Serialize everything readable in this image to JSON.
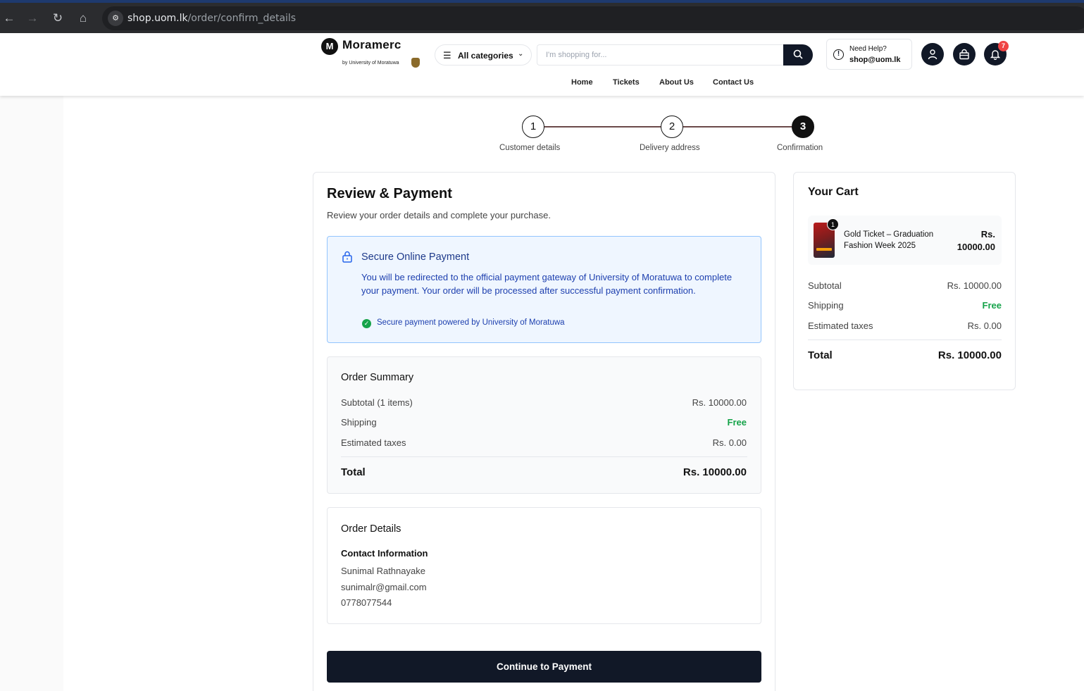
{
  "browser": {
    "back_glyph": "←",
    "forward_glyph": "→",
    "reload_glyph": "↻",
    "home_glyph": "⌂",
    "url_host": "shop.uom.lk",
    "url_path": "/order/confirm_details"
  },
  "header": {
    "brand_name": "Moramerc",
    "brand_sub": "by University of Moratuwa",
    "categories_label": "All categories",
    "search_placeholder": "I'm shopping for...",
    "help_label": "Need Help?",
    "help_email": "shop@uom.lk",
    "notification_count": "7",
    "nav": [
      "Home",
      "Tickets",
      "About Us",
      "Contact Us"
    ],
    "icons": [
      "search-icon",
      "info-icon",
      "user-icon",
      "bag-icon",
      "bell-icon",
      "menu-icon",
      "chevron-down-icon"
    ]
  },
  "stepper": {
    "steps": [
      {
        "number": "1",
        "label": "Customer details",
        "active": false
      },
      {
        "number": "2",
        "label": "Delivery address",
        "active": false
      },
      {
        "number": "3",
        "label": "Confirmation",
        "active": true
      }
    ]
  },
  "review": {
    "title": "Review & Payment",
    "subtitle": "Review your order details and complete your purchase.",
    "secure": {
      "title": "Secure Online Payment",
      "text": "You will be redirected to the official payment gateway of University of Moratuwa to complete your payment. Your order will be processed after successful payment confirmation.",
      "note": "Secure payment powered by University of Moratuwa"
    },
    "summary": {
      "title": "Order Summary",
      "subtotal_label": "Subtotal (1 items)",
      "subtotal_value": "Rs. 10000.00",
      "shipping_label": "Shipping",
      "shipping_value": "Free",
      "taxes_label": "Estimated taxes",
      "taxes_value": "Rs. 0.00",
      "total_label": "Total",
      "total_value": "Rs. 10000.00"
    },
    "details": {
      "title": "Order Details",
      "contact_title": "Contact Information",
      "name": "Sunimal Rathnayake",
      "email": "sunimalr@gmail.com",
      "phone": "0778077544"
    },
    "continue_label": "Continue to Payment"
  },
  "cart": {
    "title": "Your Cart",
    "item": {
      "quantity": "1",
      "name": "Gold Ticket – Graduation Fashion Week 2025",
      "price": "Rs. 10000.00"
    },
    "subtotal_label": "Subtotal",
    "subtotal_value": "Rs. 10000.00",
    "shipping_label": "Shipping",
    "shipping_value": "Free",
    "taxes_label": "Estimated taxes",
    "taxes_value": "Rs. 0.00",
    "total_label": "Total",
    "total_value": "Rs. 10000.00"
  },
  "colors": {
    "primary_dark": "#111827",
    "info_bg": "#eff6ff",
    "info_text": "#1e40af",
    "success": "#16a34a",
    "badge": "#ef4444"
  }
}
